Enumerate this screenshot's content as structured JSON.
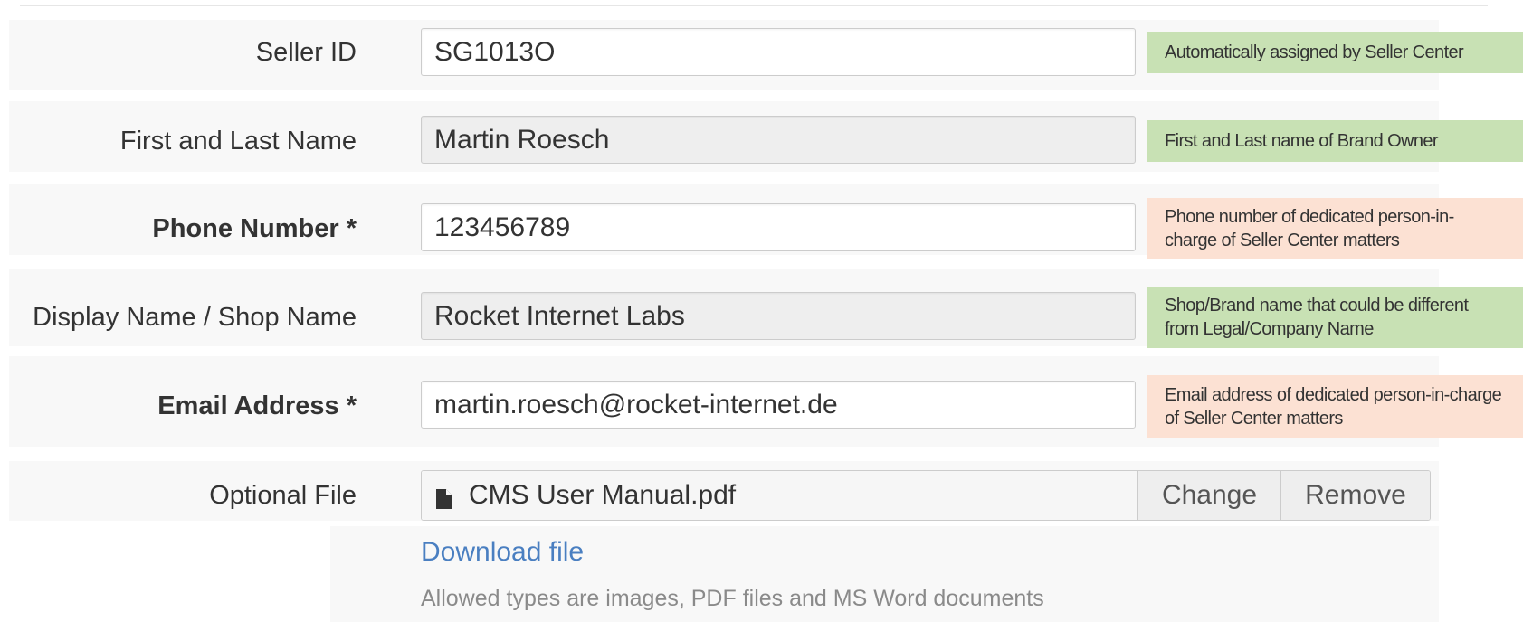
{
  "fields": [
    {
      "label": "Seller ID",
      "required": false,
      "readonly": false,
      "value": "SG1013O",
      "hint": "Automatically assigned by Seller Center",
      "hint_color": "green"
    },
    {
      "label": "First and Last Name",
      "required": false,
      "readonly": true,
      "value": "Martin Roesch",
      "hint": "First and Last name of Brand Owner",
      "hint_color": "green"
    },
    {
      "label": "Phone Number *",
      "required": true,
      "readonly": false,
      "value": "123456789",
      "hint": "Phone number of dedicated person-in-charge of Seller Center matters",
      "hint_color": "salmon"
    },
    {
      "label": "Display Name / Shop Name",
      "required": false,
      "readonly": true,
      "value": "Rocket Internet Labs",
      "hint": "Shop/Brand name that could be different from Legal/Company Name",
      "hint_color": "green"
    },
    {
      "label": "Email Address *",
      "required": true,
      "readonly": false,
      "value": "martin.roesch@rocket-internet.de",
      "hint": "Email address of dedicated person-in-charge of Seller Center matters",
      "hint_color": "salmon"
    }
  ],
  "file": {
    "label": "Optional File",
    "filename": "CMS User Manual.pdf",
    "icon": "file-icon",
    "change_label": "Change",
    "remove_label": "Remove",
    "download_label": "Download file",
    "help_text": "Allowed types are images, PDF files and MS Word documents"
  },
  "colors": {
    "hint_green": "#c8e1b4",
    "hint_salmon": "#fce1d3",
    "link": "#4a7fc1"
  }
}
